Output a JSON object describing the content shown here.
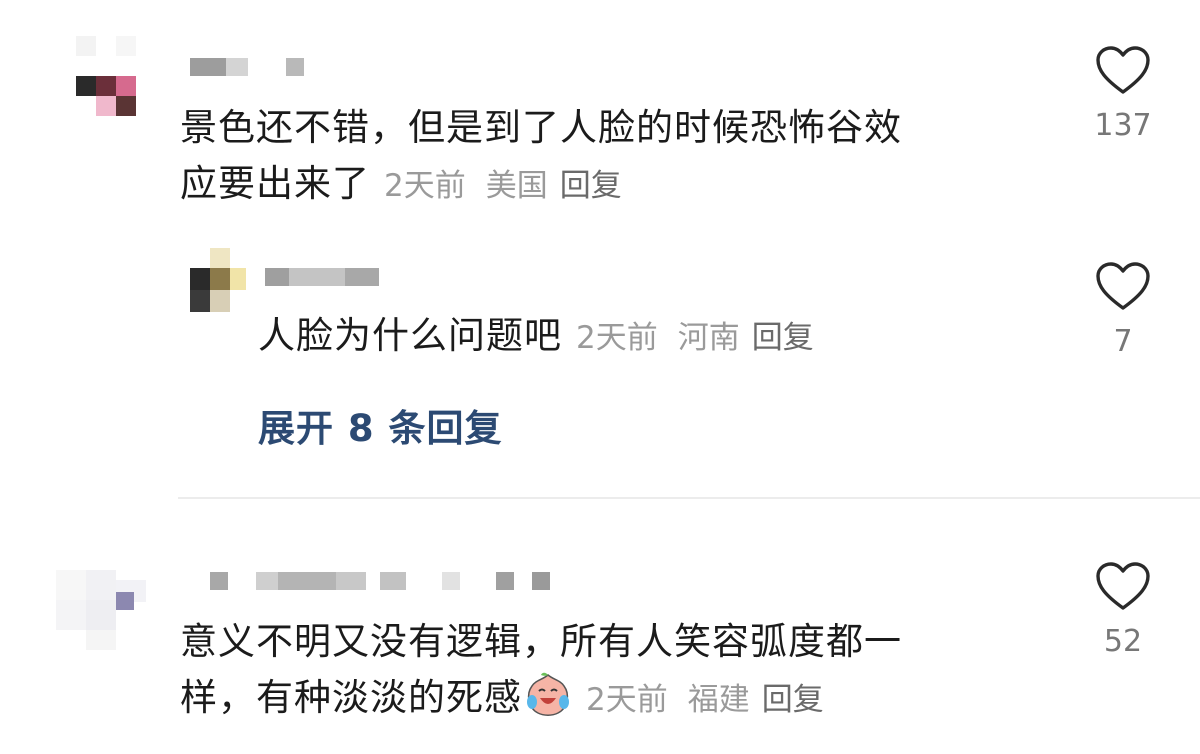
{
  "comments": [
    {
      "text_line1": "景色还不错，但是到了人脸的时候恐怖谷效",
      "text_line2": "应要出来了",
      "time": "2天前",
      "location": "美国",
      "reply_label": "回复",
      "likes": "137",
      "icons": {
        "like": "heart-outline-icon"
      },
      "reply": {
        "text": "人脸为什么问题吧",
        "time": "2天前",
        "location": "河南",
        "reply_label": "回复",
        "likes": "7",
        "icons": {
          "like": "heart-outline-icon"
        }
      },
      "expand_label": "展开 8 条回复"
    },
    {
      "text_line1": "意义不明又没有逻辑，所有人笑容弧度都一",
      "text_line2": "样，有种淡淡的死感",
      "emoji": "crying-laughing-peach-emoji",
      "time": "2天前",
      "location": "福建",
      "reply_label": "回复",
      "likes": "52",
      "icons": {
        "like": "heart-outline-icon"
      }
    }
  ],
  "colors": {
    "link": "#2c4a73",
    "meta": "#9a9a9a",
    "divider": "#ececec"
  }
}
